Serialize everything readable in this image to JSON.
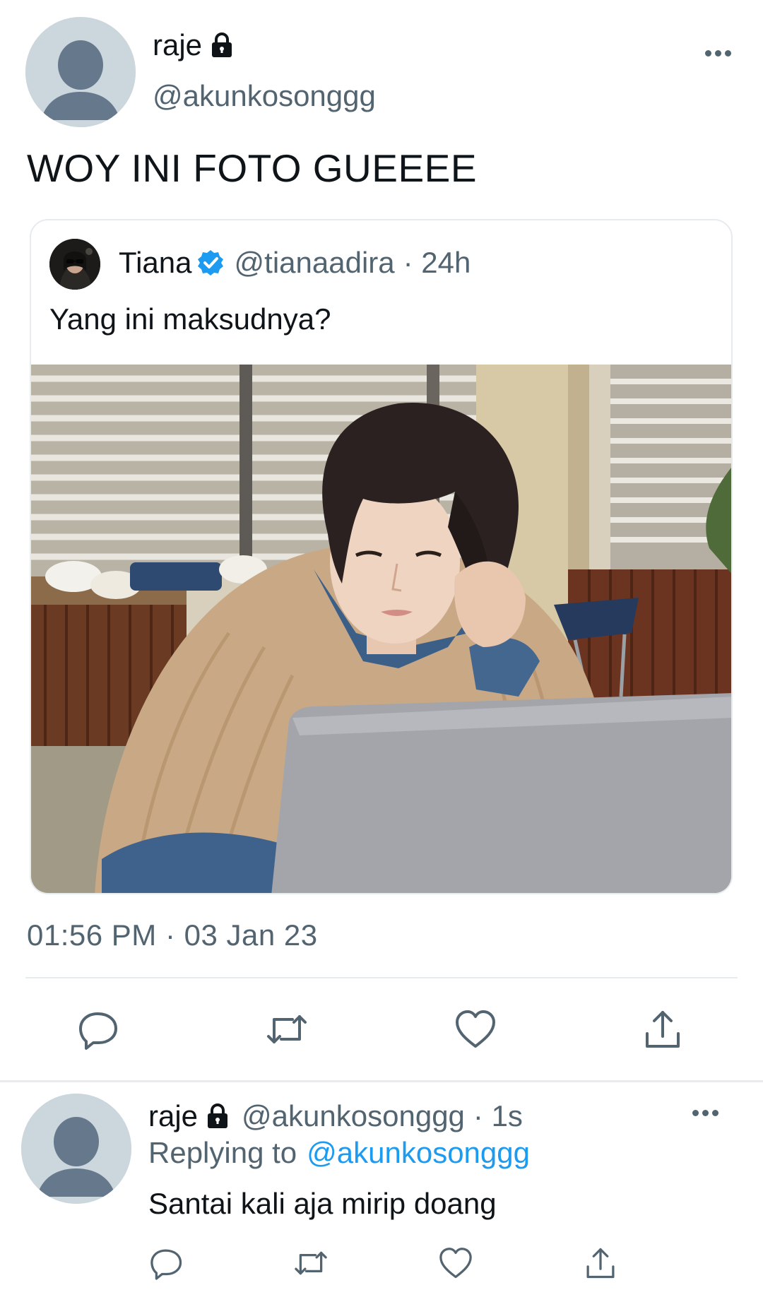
{
  "main_tweet": {
    "display_name": "raje",
    "handle": "@akunkosonggg",
    "text": "WOY INI FOTO GUEEEE",
    "timestamp": "01:56 PM · 03 Jan 23"
  },
  "quoted_tweet": {
    "display_name": "Tiana",
    "handle": "@tianaadira",
    "time": "· 24h",
    "text": "Yang ini maksudnya?"
  },
  "reply_tweet": {
    "display_name": "raje",
    "handle": "@akunkosonggg",
    "time": "· 1s",
    "replying_prefix": "Replying to",
    "replying_handle": "@akunkosonggg",
    "text": "Santai kali aja mirip doang"
  },
  "icons": [
    "avatar-default-icon",
    "lock-icon",
    "more-icon",
    "verified-icon",
    "reply-icon",
    "retweet-icon",
    "like-icon",
    "share-icon"
  ],
  "colors": {
    "text_primary": "#0f1419",
    "text_secondary": "#536471",
    "accent": "#1d9bf0",
    "divider": "#e6ebee",
    "avatar_bg": "#ccd6dd"
  }
}
